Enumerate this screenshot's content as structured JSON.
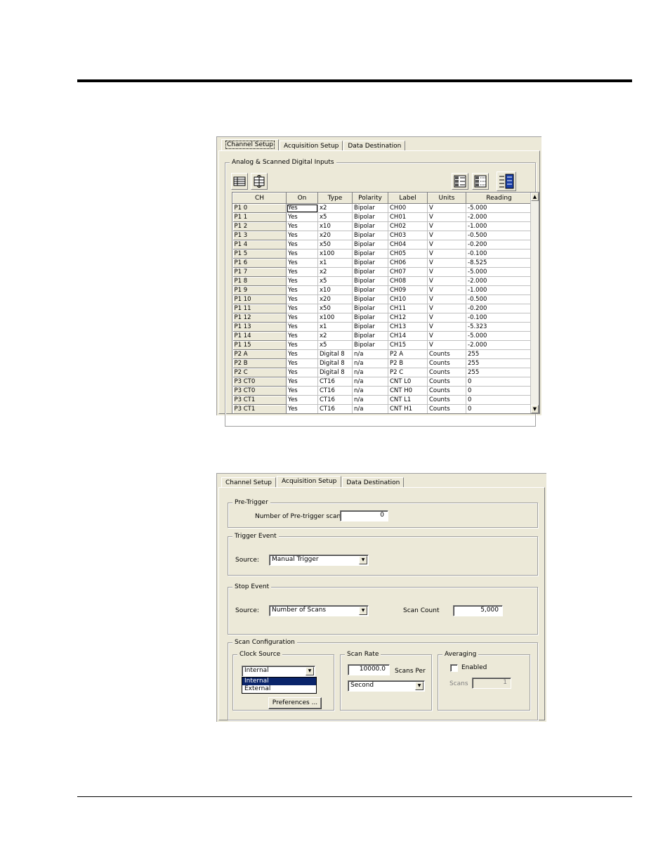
{
  "dialog1": {
    "tabs": [
      "Channel Setup",
      "Acquisition Setup",
      "Data Destination"
    ],
    "active_tab": "Channel Setup",
    "group_title": "Analog & Scanned Digital Inputs",
    "toolbar_icons": [
      "grid-view-icon",
      "spread-settings-icon",
      "all-on-icon",
      "all-off-icon",
      "channel-list-icon"
    ],
    "columns": [
      "CH",
      "On",
      "Type",
      "Polarity",
      "Label",
      "Units",
      "Reading"
    ],
    "rows": [
      [
        "P1 0",
        "Yes",
        "x2",
        "Bipolar",
        "CH00",
        "V",
        "-5.000"
      ],
      [
        "P1 1",
        "Yes",
        "x5",
        "Bipolar",
        "CH01",
        "V",
        "-2.000"
      ],
      [
        "P1 2",
        "Yes",
        "x10",
        "Bipolar",
        "CH02",
        "V",
        "-1.000"
      ],
      [
        "P1 3",
        "Yes",
        "x20",
        "Bipolar",
        "CH03",
        "V",
        "-0.500"
      ],
      [
        "P1 4",
        "Yes",
        "x50",
        "Bipolar",
        "CH04",
        "V",
        "-0.200"
      ],
      [
        "P1 5",
        "Yes",
        "x100",
        "Bipolar",
        "CH05",
        "V",
        "-0.100"
      ],
      [
        "P1 6",
        "Yes",
        "x1",
        "Bipolar",
        "CH06",
        "V",
        "-8.525"
      ],
      [
        "P1 7",
        "Yes",
        "x2",
        "Bipolar",
        "CH07",
        "V",
        "-5.000"
      ],
      [
        "P1 8",
        "Yes",
        "x5",
        "Bipolar",
        "CH08",
        "V",
        "-2.000"
      ],
      [
        "P1 9",
        "Yes",
        "x10",
        "Bipolar",
        "CH09",
        "V",
        "-1.000"
      ],
      [
        "P1 10",
        "Yes",
        "x20",
        "Bipolar",
        "CH10",
        "V",
        "-0.500"
      ],
      [
        "P1 11",
        "Yes",
        "x50",
        "Bipolar",
        "CH11",
        "V",
        "-0.200"
      ],
      [
        "P1 12",
        "Yes",
        "x100",
        "Bipolar",
        "CH12",
        "V",
        "-0.100"
      ],
      [
        "P1 13",
        "Yes",
        "x1",
        "Bipolar",
        "CH13",
        "V",
        "-5.323"
      ],
      [
        "P1 14",
        "Yes",
        "x2",
        "Bipolar",
        "CH14",
        "V",
        "-5.000"
      ],
      [
        "P1 15",
        "Yes",
        "x5",
        "Bipolar",
        "CH15",
        "V",
        "-2.000"
      ],
      [
        "P2 A",
        "Yes",
        "Digital 8",
        "n/a",
        "P2 A",
        "Counts",
        "255"
      ],
      [
        "P2 B",
        "Yes",
        "Digital 8",
        "n/a",
        "P2 B",
        "Counts",
        "255"
      ],
      [
        "P2 C",
        "Yes",
        "Digital 8",
        "n/a",
        "P2 C",
        "Counts",
        "255"
      ],
      [
        "P3 CT0",
        "Yes",
        "CT16",
        "n/a",
        "CNT L0",
        "Counts",
        "0"
      ],
      [
        "P3 CT0",
        "Yes",
        "CT16",
        "n/a",
        "CNT H0",
        "Counts",
        "0"
      ],
      [
        "P3 CT1",
        "Yes",
        "CT16",
        "n/a",
        "CNT L1",
        "Counts",
        "0"
      ],
      [
        "P3 CT1",
        "Yes",
        "CT16",
        "n/a",
        "CNT H1",
        "Counts",
        "0"
      ]
    ],
    "scroll_up": "▲",
    "scroll_down": "▼"
  },
  "dialog2": {
    "tabs": [
      "Channel Setup",
      "Acquisition Setup",
      "Data Destination"
    ],
    "active_tab": "Acquisition Setup",
    "pretrigger": {
      "title": "Pre-Trigger",
      "label": "Number of Pre-trigger scans:",
      "value": "0"
    },
    "trigger": {
      "title": "Trigger Event",
      "source_label": "Source:",
      "source_value": "Manual Trigger"
    },
    "stop": {
      "title": "Stop Event",
      "source_label": "Source:",
      "source_value": "Number of Scans",
      "count_label": "Scan Count",
      "count_value": "5,000"
    },
    "scan_config": {
      "title": "Scan Configuration",
      "clock": {
        "title": "Clock Source",
        "value": "Internal",
        "options": [
          "Internal",
          "External"
        ],
        "highlighted": "Internal",
        "preferences_label": "Preferences ..."
      },
      "rate": {
        "title": "Scan Rate",
        "value": "10000.0",
        "per_label": "Scans Per",
        "unit_value": "Second"
      },
      "averaging": {
        "title": "Averaging",
        "enabled_label": "Enabled",
        "enabled_checked": false,
        "scans_label": "Scans",
        "scans_value": "1"
      }
    },
    "combo_arrow": "▼"
  }
}
